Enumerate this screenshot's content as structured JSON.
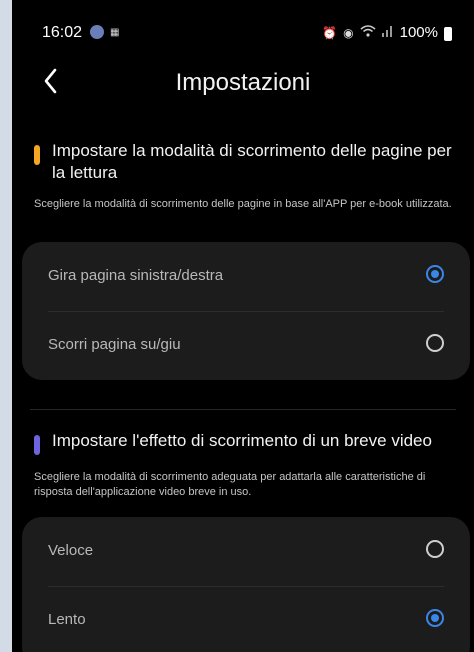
{
  "status_bar": {
    "time": "16:02",
    "battery": "100%",
    "icons": [
      "notification-icon",
      "app-icon",
      "alarm-icon",
      "clock-icon",
      "wifi-icon",
      "signal-icon",
      "battery-icon"
    ]
  },
  "header": {
    "title": "Impostazioni",
    "back_icon": "chevron-left-icon"
  },
  "sections": [
    {
      "accent_color": "#f5a623",
      "title": "Impostare la modalità di scorrimento delle pagine per la lettura",
      "description": "Scegliere la modalità di scorrimento delle pagine in base all'APP per e-book utilizzata.",
      "options": [
        {
          "label": "Gira pagina sinistra/destra",
          "selected": true
        },
        {
          "label": "Scorri pagina su/giu",
          "selected": false
        }
      ]
    },
    {
      "accent_color": "#6e64e0",
      "title": "Impostare l'effetto di scorrimento di un breve video",
      "description": "Scegliere la modalità di scorrimento adeguata per adattarla alle caratteristiche di risposta dell'applicazione video breve in uso.",
      "options": [
        {
          "label": "Veloce",
          "selected": false
        },
        {
          "label": "Lento",
          "selected": true
        }
      ]
    }
  ],
  "colors": {
    "background": "#000000",
    "card": "#1c1c1c",
    "radio_selected": "#3a87e8"
  }
}
